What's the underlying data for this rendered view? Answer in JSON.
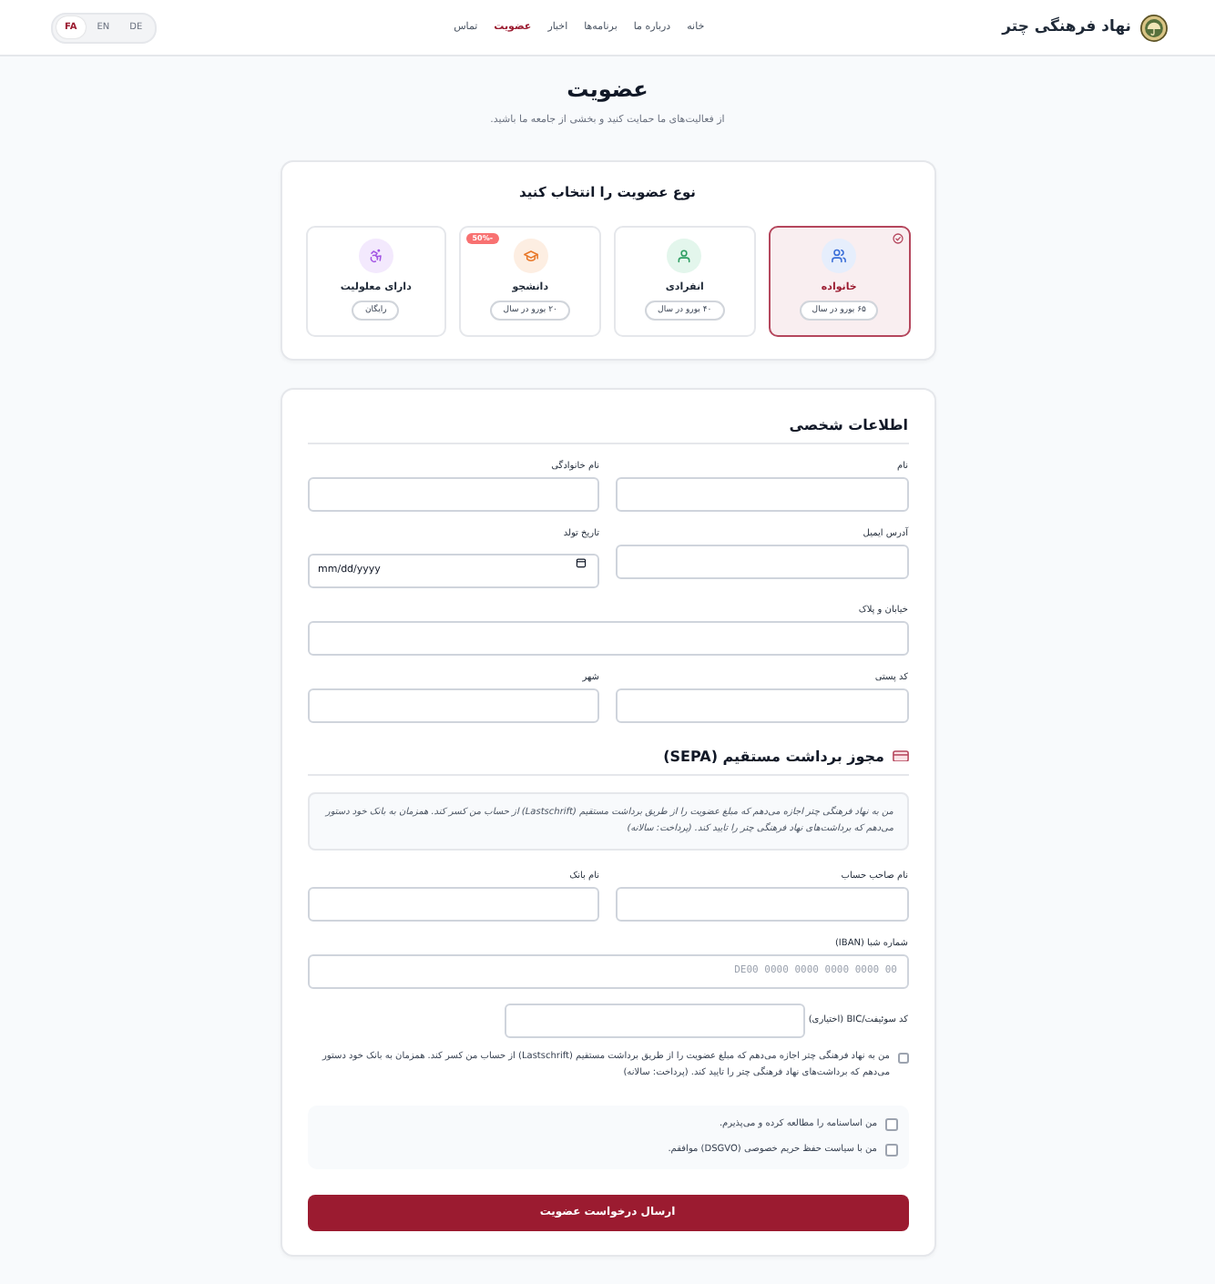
{
  "header": {
    "brand": "نهاد فرهنگی چتر",
    "nav": [
      {
        "label": "خانه",
        "selected": false
      },
      {
        "label": "درباره ما",
        "selected": false
      },
      {
        "label": "برنامه‌ها",
        "selected": false
      },
      {
        "label": "اخبار",
        "selected": false
      },
      {
        "label": "عضویت",
        "selected": true
      },
      {
        "label": "تماس",
        "selected": false
      }
    ],
    "languages": [
      {
        "label": "DE",
        "selected": false
      },
      {
        "label": "EN",
        "selected": false
      },
      {
        "label": "FA",
        "selected": true
      }
    ]
  },
  "page": {
    "title": "عضویت",
    "subtitle": "از فعالیت‌های ما حمایت کنید و بخشی از جامعه ما باشید."
  },
  "membership": {
    "title": "نوع عضویت را انتخاب کنید",
    "options": [
      {
        "kind": "family",
        "name": "خانواده",
        "price": "۶۵ یورو در سال",
        "selected": true
      },
      {
        "kind": "individual",
        "name": "انفرادی",
        "price": "۴۰ یورو در سال",
        "selected": false
      },
      {
        "kind": "student",
        "name": "دانشجو",
        "price": "۲۰ یورو در سال",
        "badge": "-50%",
        "selected": false
      },
      {
        "kind": "disability",
        "name": "دارای معلولیت",
        "price": "رایگان",
        "selected": false
      }
    ]
  },
  "personal": {
    "title": "اطلاعات شخصی",
    "rows": [
      [
        {
          "kind": "text",
          "label": "نام"
        },
        {
          "kind": "text",
          "label": "نام خانوادگی"
        }
      ],
      [
        {
          "kind": "text",
          "label": "آدرس ایمیل"
        },
        {
          "kind": "date",
          "label": "تاریخ تولد",
          "placeholder": "mm/dd/yyyy"
        }
      ],
      [
        {
          "kind": "text",
          "label": "خیابان و پلاک"
        }
      ],
      [
        {
          "kind": "text",
          "label": "کد پستی"
        },
        {
          "kind": "text",
          "label": "شهر"
        }
      ]
    ]
  },
  "sepa": {
    "title": "مجوز برداشت مستقیم (SEPA)",
    "notice": "من به نهاد فرهنگی چتر اجازه می‌دهم که مبلغ عضویت را از طریق برداشت مستقیم (Lastschrift) از حساب من کسر کند. همزمان به بانک خود دستور می‌دهم که برداشت‌های نهاد فرهنگی چتر را تایید کند. (پرداخت: سالانه)",
    "rows": [
      [
        {
          "kind": "text",
          "label": "نام صاحب حساب"
        },
        {
          "kind": "text",
          "label": "نام بانک"
        }
      ],
      [
        {
          "kind": "code",
          "label": "شماره شبا (IBAN)",
          "placeholder": "DE00 0000 0000 0000 0000 00"
        }
      ]
    ],
    "bic": {
      "label": "کد سوئیفت/BIC (اختیاری)"
    },
    "mandate": {
      "label": "من به نهاد فرهنگی چتر اجازه می‌دهم که مبلغ عضویت را از طریق برداشت مستقیم (Lastschrift) از حساب من کسر کند. همزمان به بانک خود دستور می‌دهم که برداشت‌های نهاد فرهنگی چتر را تایید کند. (پرداخت: سالانه)",
      "checked": false
    }
  },
  "consents": [
    {
      "label": "من اساسنامه را مطالعه کرده و می‌پذیرم.",
      "checked": false
    },
    {
      "label": "من با سیاست حفظ حریم خصوصی (DSGVO) موافقم.",
      "checked": false
    }
  ],
  "submit": {
    "label": "ارسال درخواست عضویت"
  }
}
